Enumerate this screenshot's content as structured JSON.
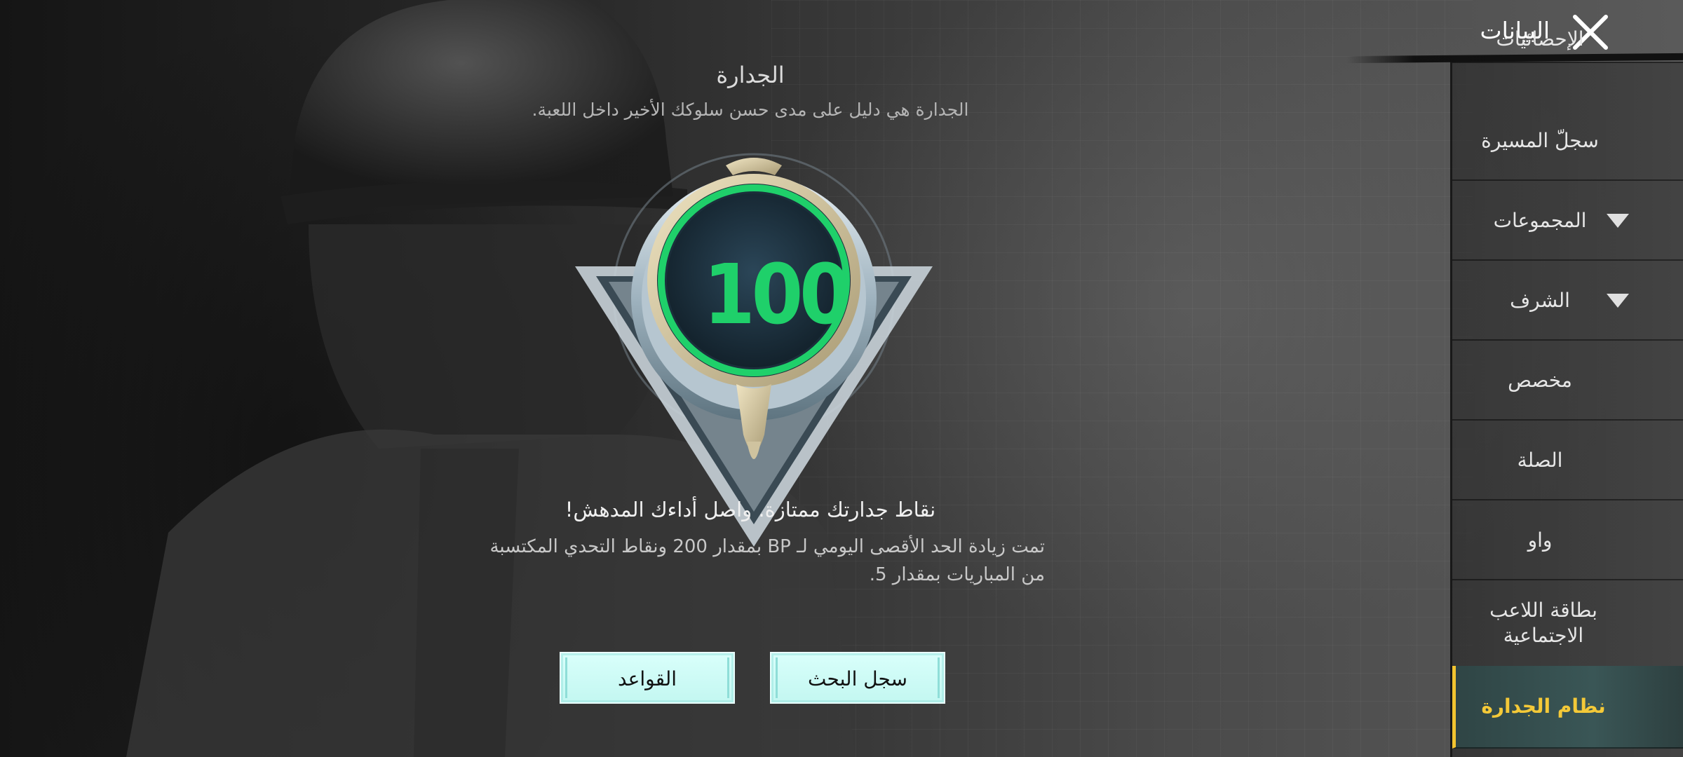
{
  "header": {
    "title": "البيانات"
  },
  "sidebar": {
    "items": [
      {
        "label": "الإحصائيات",
        "active": false,
        "expandable": false
      },
      {
        "label": "سجلّ المسيرة",
        "active": false,
        "expandable": false
      },
      {
        "label": "المجموعات",
        "active": false,
        "expandable": true
      },
      {
        "label": "الشرف",
        "active": false,
        "expandable": true
      },
      {
        "label": "مخصص",
        "active": false,
        "expandable": false
      },
      {
        "label": "الصلة",
        "active": false,
        "expandable": false
      },
      {
        "label": "واو",
        "active": false,
        "expandable": false
      },
      {
        "label": "بطاقة اللاعب الاجتماعية",
        "active": false,
        "expandable": false
      },
      {
        "label": "نظام الجدارة",
        "active": true,
        "expandable": false
      }
    ]
  },
  "merit": {
    "title": "الجدارة",
    "subtitle": "الجدارة هي دليل على مدى حسن سلوكك الأخير داخل اللعبة.",
    "score": "100",
    "status_message": "نقاط جدارتك ممتازة. واصل أداءك المدهش!",
    "description": "تمت زيادة الحد الأقصى اليومي لـ BP بمقدار 200 ونقاط التحدي المكتسبة من المباريات بمقدار 5."
  },
  "buttons": {
    "rules": "القواعد",
    "search_history": "سجل البحث"
  },
  "colors": {
    "score_green": "#1fd06a",
    "active_accent": "#f2c430",
    "button_bg": "#c3f7f1"
  }
}
